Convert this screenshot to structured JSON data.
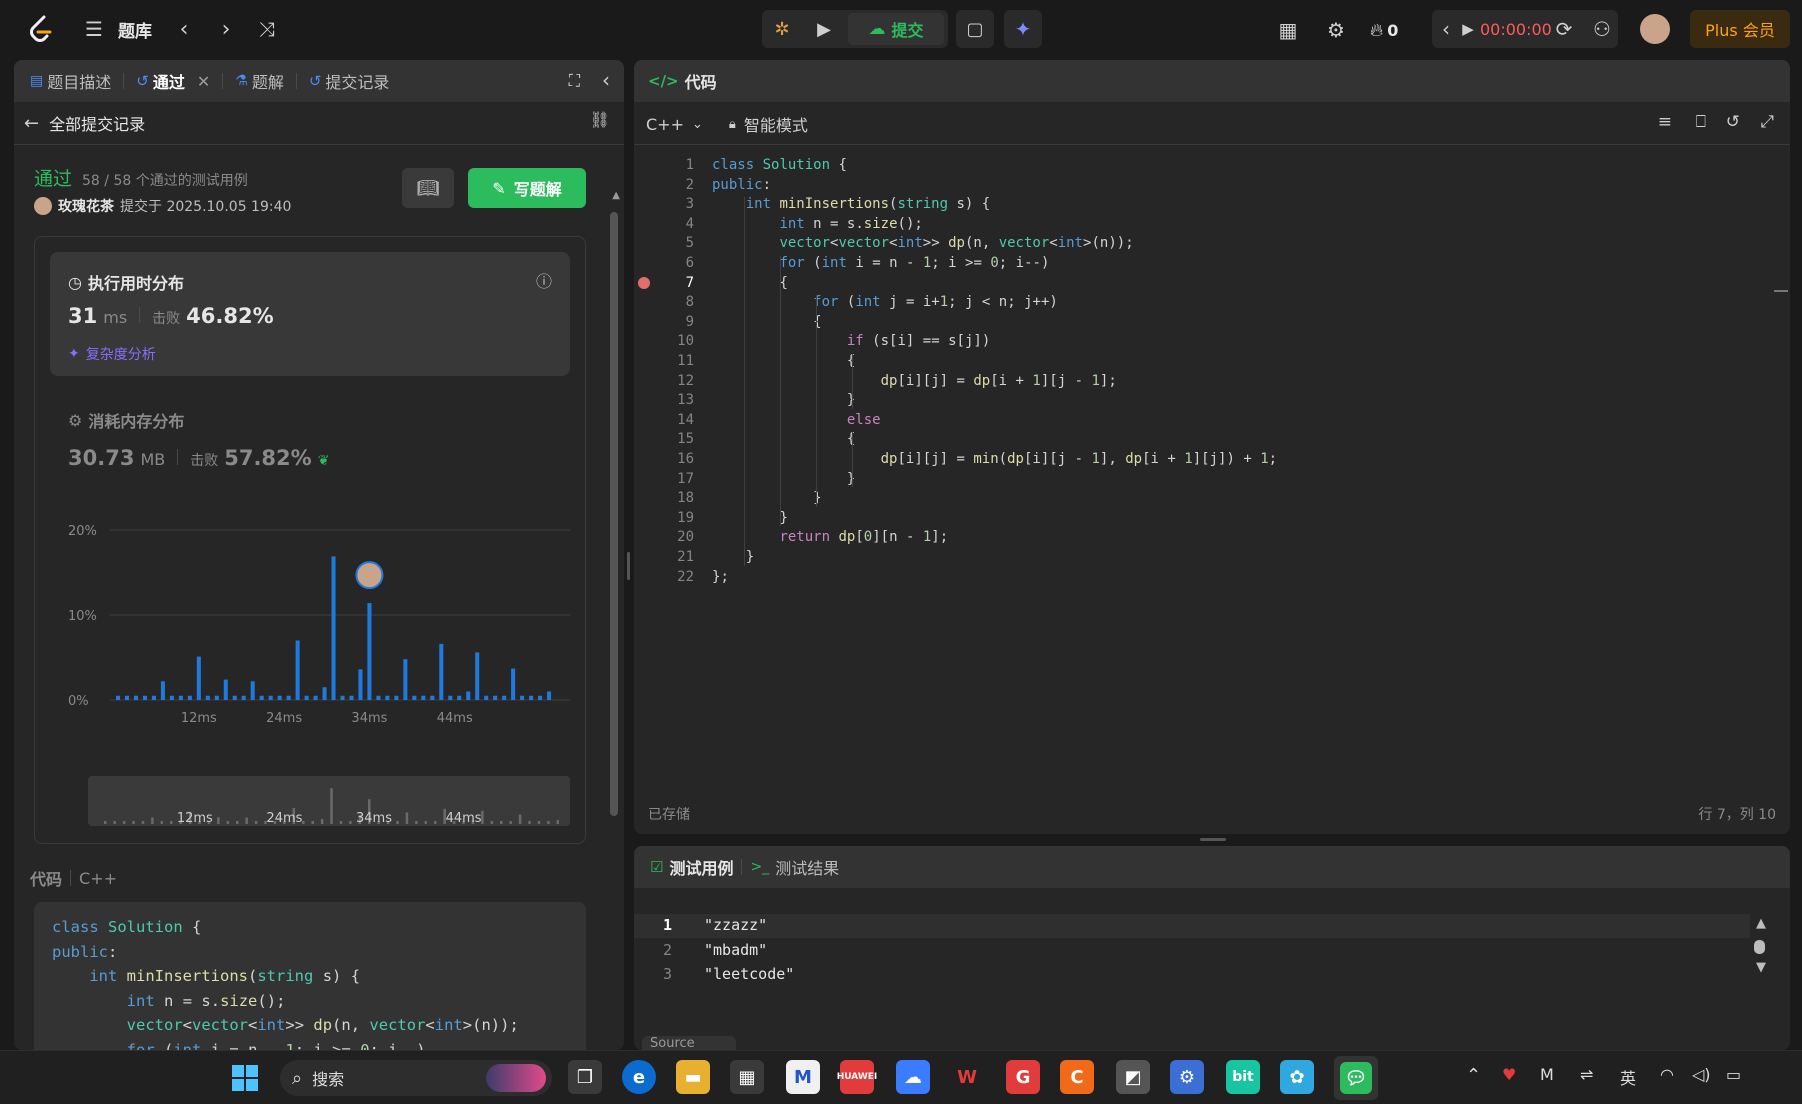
{
  "topbar": {
    "problem_bank": "题库",
    "submit": "提交",
    "streak": "0",
    "timer": "00:00:00",
    "plus": "Plus 会员"
  },
  "left_tabs": {
    "description": "题目描述",
    "accepted": "通过",
    "solutions": "题解",
    "submissions": "提交记录"
  },
  "left": {
    "back_label": "全部提交记录",
    "status": "通过",
    "passed_cases": "58 / 58 个通过的测试用例",
    "user": "玫瑰花茶",
    "submitted_at": "提交于 2025.10.05 19:40",
    "write_solution": "写题解",
    "runtime_title": "执行用时分布",
    "runtime_value": "31",
    "runtime_unit": "ms",
    "beats_label": "击败",
    "runtime_beats": "46.82%",
    "complexity": "复杂度分析",
    "memory_title": "消耗内存分布",
    "memory_value": "30.73",
    "memory_unit": "MB",
    "memory_beats": "57.82%",
    "code_label": "代码",
    "code_lang": "C++"
  },
  "chart_data": {
    "type": "bar",
    "title": "",
    "y_ticks": [
      "20%",
      "10%",
      "0%"
    ],
    "x_ticks": [
      "12ms",
      "24ms",
      "34ms",
      "44ms"
    ],
    "ylim": [
      0,
      20
    ],
    "values": [
      0.5,
      0.5,
      0.5,
      0.5,
      0.5,
      2.2,
      0.5,
      0.5,
      0.5,
      5.1,
      0.5,
      0.5,
      2.4,
      0.5,
      0.5,
      2.2,
      0.5,
      0.5,
      0.5,
      0.5,
      7.0,
      0.5,
      0.5,
      1.5,
      16.9,
      0.5,
      0.5,
      3.6,
      11.4,
      0.5,
      0.5,
      0.5,
      4.8,
      0.5,
      0.5,
      0.5,
      6.6,
      0.5,
      0.5,
      1.0,
      5.6,
      0.5,
      0.5,
      0.5,
      3.7,
      0.5,
      0.5,
      0.5,
      1.0
    ],
    "highlight_index": 28,
    "minimap_ticks": [
      "12ms",
      "24ms",
      "34ms",
      "44ms"
    ]
  },
  "editor": {
    "tab_label": "代码",
    "lang": "C++",
    "mode": "智能模式",
    "saved": "已存储",
    "cursor": "行 7，列 10",
    "breakpoint_line": 7,
    "lines": [
      "class Solution {",
      "public:",
      "    int minInsertions(string s) {",
      "        int n = s.size();",
      "        vector<vector<int>> dp(n, vector<int>(n));",
      "        for (int i = n - 1; i >= 0; i--)",
      "        {",
      "            for (int j = i+1; j < n; j++)",
      "            {",
      "                if (s[i] == s[j])",
      "                {",
      "                    dp[i][j] = dp[i + 1][j - 1];",
      "                }",
      "                else",
      "                {",
      "                    dp[i][j] = min(dp[i][j - 1], dp[i + 1][j]) + 1;",
      "                }",
      "            }",
      "        }",
      "        return dp[0][n - 1];",
      "    }",
      "};"
    ]
  },
  "left_code_lines": [
    "class Solution {",
    "public:",
    "    int minInsertions(string s) {",
    "        int n = s.size();",
    "        vector<vector<int>> dp(n, vector<int>(n));",
    "        for (int i = n - 1; i >= 0; i--)"
  ],
  "testcase": {
    "tab_cases": "测试用例",
    "tab_result": "测试结果",
    "cases": [
      "\"zzazz\"",
      "\"mbadm\"",
      "\"leetcode\""
    ],
    "source_label": "Source"
  },
  "taskbar": {
    "search": "搜索",
    "lang": "英"
  }
}
